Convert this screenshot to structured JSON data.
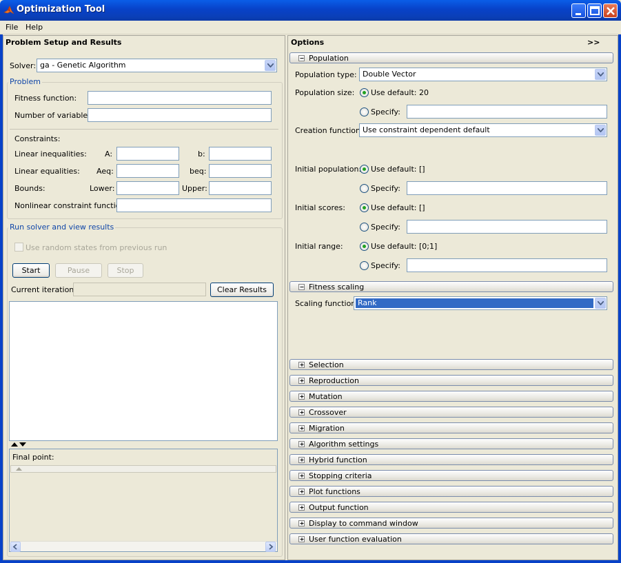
{
  "window": {
    "title": "Optimization Tool",
    "menu": [
      "File",
      "Help"
    ]
  },
  "left": {
    "header": "Problem Setup and Results",
    "solver_label": "Solver:",
    "solver_value": "ga - Genetic Algorithm",
    "problem_group": "Problem",
    "fitness_label": "Fitness function:",
    "numvars_label": "Number of variables:",
    "constraints_label": "Constraints:",
    "lin_ineq_label": "Linear inequalities:",
    "a_label": "A:",
    "b_label": "b:",
    "lin_eq_label": "Linear equalities:",
    "aeq_label": "Aeq:",
    "beq_label": "beq:",
    "bounds_label": "Bounds:",
    "lower_label": "Lower:",
    "upper_label": "Upper:",
    "nonlinear_label": "Nonlinear constraint function:",
    "run_group": "Run solver and view results",
    "random_states_label": "Use random states from previous run",
    "start_btn": "Start",
    "pause_btn": "Pause",
    "stop_btn": "Stop",
    "current_iter_label": "Current iteration:",
    "clear_btn": "Clear Results",
    "final_point_label": "Final point:"
  },
  "right": {
    "header": "Options",
    "expand_btn": ">>",
    "population": {
      "title": "Population",
      "type_label": "Population type:",
      "type_value": "Double Vector",
      "size_label": "Population size:",
      "use_default_20": "Use default: 20",
      "specify": "Specify:",
      "creation_label": "Creation function:",
      "creation_value": "Use constraint dependent default",
      "init_pop_label": "Initial population:",
      "use_default_empty": "Use default: []",
      "init_scores_label": "Initial scores:",
      "init_range_label": "Initial range:",
      "use_default_range": "Use default: [0;1]"
    },
    "fitness_scaling": {
      "title": "Fitness scaling",
      "scaling_label": "Scaling function:",
      "scaling_value": "Rank"
    },
    "sections": [
      "Selection",
      "Reproduction",
      "Mutation",
      "Crossover",
      "Migration",
      "Algorithm settings",
      "Hybrid function",
      "Stopping criteria",
      "Plot functions",
      "Output function",
      "Display to command window",
      "User function evaluation"
    ]
  },
  "colors": {
    "titlebar": "#0842c8",
    "accent_text": "#1046a8",
    "selection": "#316ac5"
  }
}
